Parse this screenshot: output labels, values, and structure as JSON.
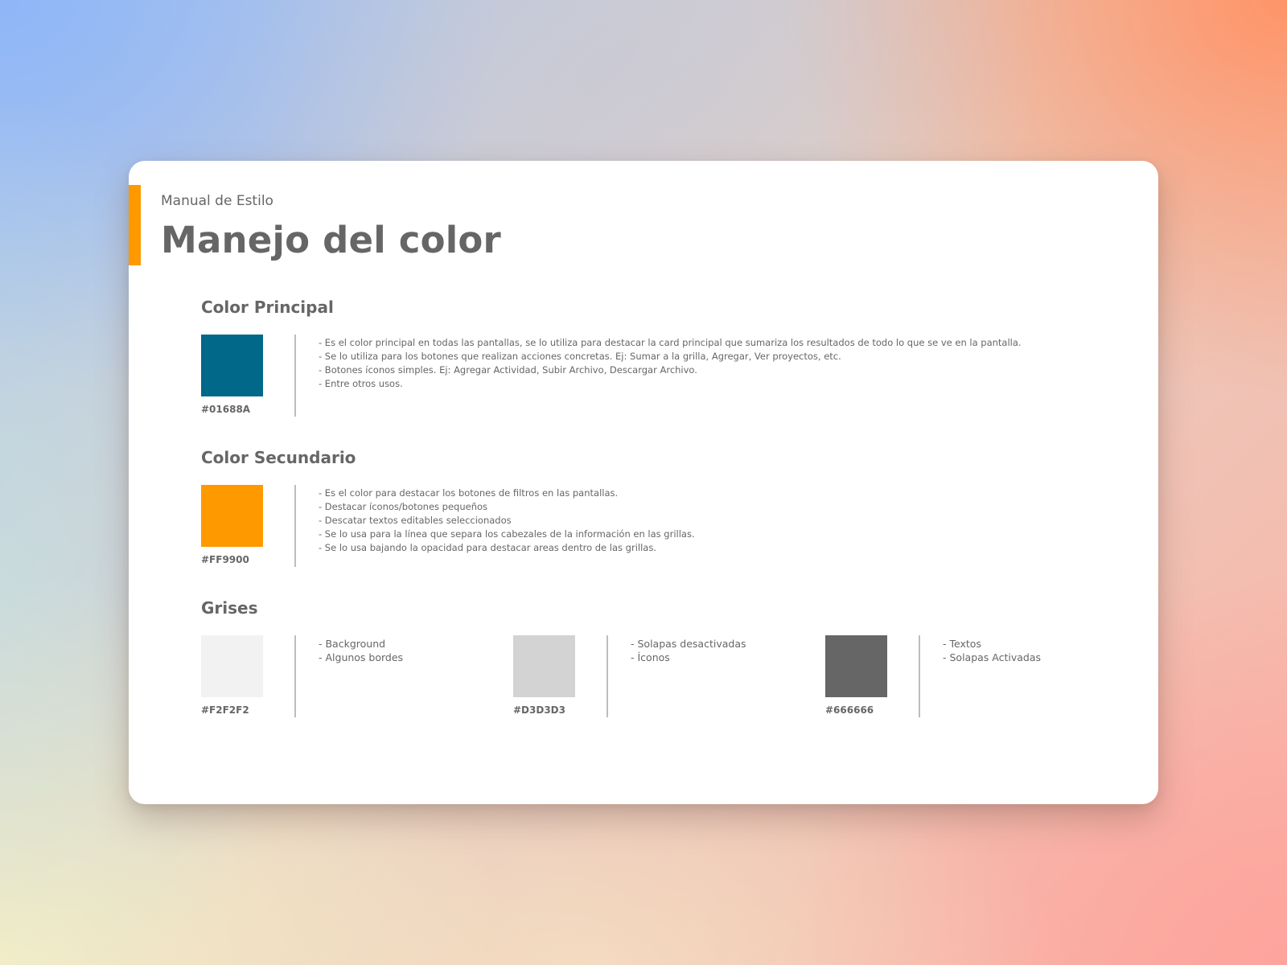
{
  "header": {
    "kicker": "Manual de Estilo",
    "title": "Manejo del color"
  },
  "sections": {
    "principal": {
      "title": "Color Principal",
      "color": "#01688A",
      "hex": "#01688A",
      "lines": [
        "- Es el color principal en todas las pantallas, se lo utiliza para destacar la card principal que sumariza los resultados de todo lo que se ve en la pantalla.",
        "- Se lo utiliza para los botones que realizan acciones concretas. Ej: Sumar a la grilla, Agregar, Ver proyectos, etc.",
        "- Botones íconos simples. Ej: Agregar Actividad, Subir Archivo, Descargar Archivo.",
        "- Entre otros usos."
      ]
    },
    "secundario": {
      "title": "Color Secundario",
      "color": "#FF9900",
      "hex": "#FF9900",
      "lines": [
        "- Es el color para destacar los botones de filtros en las pantallas.",
        "- Destacar íconos/botones pequeños",
        "- Descatar textos editables seleccionados",
        "- Se lo usa para la línea que separa los cabezales de la información en las grillas.",
        "- Se lo usa bajando la opacidad para destacar areas dentro de las grillas."
      ]
    },
    "grises": {
      "title": "Grises",
      "items": [
        {
          "color": "#F2F2F2",
          "hex": "#F2F2F2",
          "lines": [
            "- Background",
            "- Algunos bordes"
          ]
        },
        {
          "color": "#D3D3D3",
          "hex": "#D3D3D3",
          "lines": [
            "- Solapas desactivadas",
            "- Íconos"
          ]
        },
        {
          "color": "#666666",
          "hex": "#666666",
          "lines": [
            "- Textos",
            "- Solapas Activadas"
          ]
        }
      ]
    }
  },
  "colors": {
    "accent": "#FF9900",
    "text": "#666666",
    "card": "#FFFFFF"
  }
}
